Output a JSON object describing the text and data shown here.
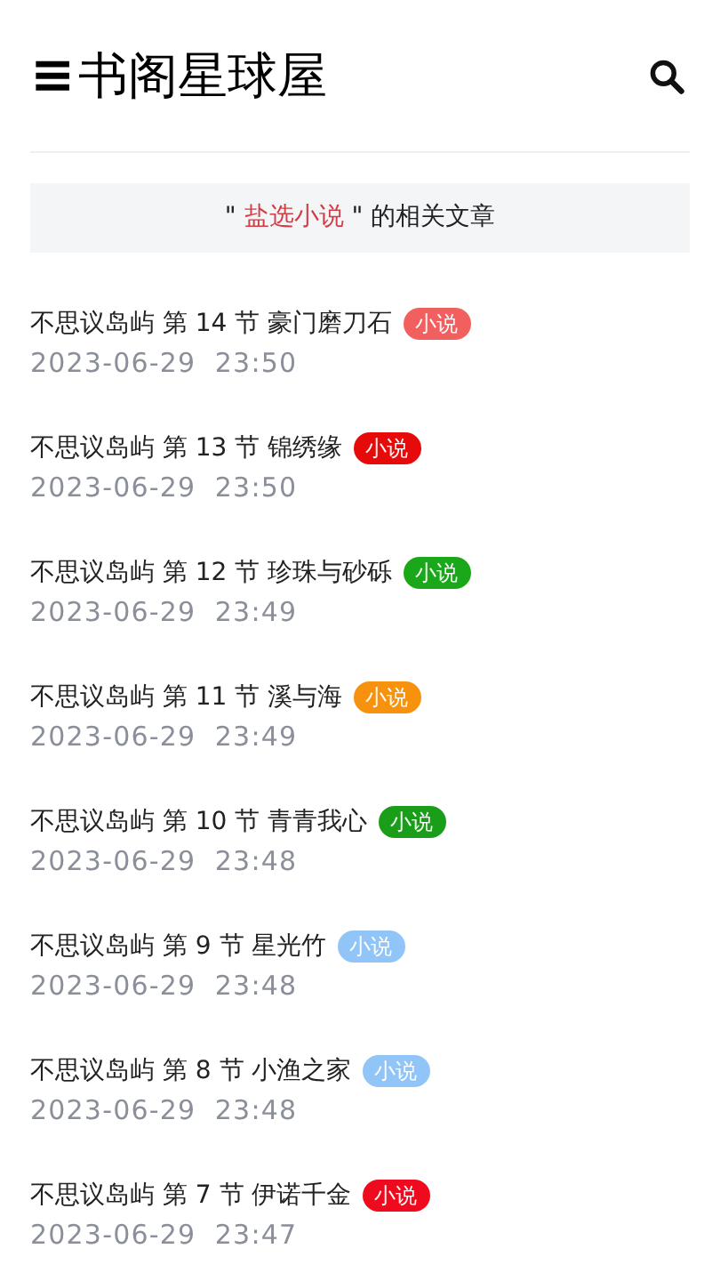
{
  "header": {
    "menu_icon": "≡",
    "title": "书阁星球屋"
  },
  "banner": {
    "before": "\" ",
    "keyword": "盐选小说",
    "after": " \" 的相关文章"
  },
  "articles": [
    {
      "title": "不思议岛屿 第 14 节 豪门磨刀石",
      "tag": "小说",
      "color": "#f25f5f",
      "date": "2023-06-29  23:50"
    },
    {
      "title": "不思议岛屿 第 13 节 锦绣缘",
      "tag": "小说",
      "color": "#e60a0a",
      "date": "2023-06-29  23:50"
    },
    {
      "title": "不思议岛屿 第 12 节 珍珠与砂砾",
      "tag": "小说",
      "color": "#1aa81a",
      "date": "2023-06-29  23:49"
    },
    {
      "title": "不思议岛屿 第 11 节 溪与海",
      "tag": "小说",
      "color": "#f7920f",
      "date": "2023-06-29  23:49"
    },
    {
      "title": "不思议岛屿 第 10 节 青青我心",
      "tag": "小说",
      "color": "#1a9e1a",
      "date": "2023-06-29  23:48"
    },
    {
      "title": "不思议岛屿 第 9 节 星光竹",
      "tag": "小说",
      "color": "#92c5f7",
      "date": "2023-06-29  23:48"
    },
    {
      "title": "不思议岛屿 第 8 节 小渔之家",
      "tag": "小说",
      "color": "#92c5f7",
      "date": "2023-06-29  23:48"
    },
    {
      "title": "不思议岛屿 第 7 节 伊诺千金",
      "tag": "小说",
      "color": "#f00a1e",
      "date": "2023-06-29  23:47"
    }
  ]
}
